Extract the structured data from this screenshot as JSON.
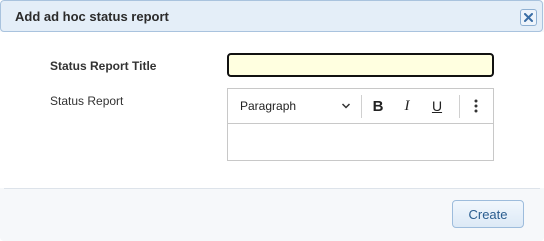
{
  "dialog": {
    "title": "Add ad hoc status report",
    "close_icon": "close-icon"
  },
  "form": {
    "title_label": "Status Report Title",
    "title_value": "",
    "report_label": "Status Report",
    "editor": {
      "format_selected": "Paragraph",
      "toolbar_icons": [
        "chevron-down-icon",
        "bold-icon",
        "italic-icon",
        "underline-icon",
        "more-options-icon"
      ],
      "bold_glyph": "B",
      "italic_glyph": "I",
      "underline_glyph": "U",
      "content": ""
    }
  },
  "footer": {
    "create_label": "Create"
  },
  "colors": {
    "titlebar_bg": "#e4eef8",
    "input_bg": "#ffffe0",
    "button_text": "#2a5d8f"
  }
}
